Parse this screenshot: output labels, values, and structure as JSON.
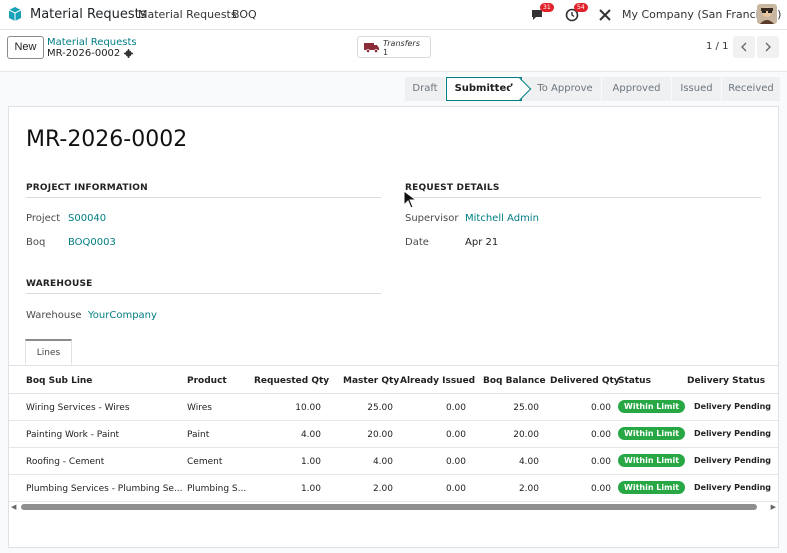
{
  "navbar": {
    "app_title": "Material Requests",
    "menus": [
      "Material Requests",
      "BOQ"
    ],
    "messages_badge": "31",
    "activities_badge": "54",
    "company": "My Company (San Francisco)"
  },
  "control_panel": {
    "new_label": "New",
    "breadcrumb_parent": "Material Requests",
    "record_name": "MR-2026-0002",
    "smart_button": {
      "label": "Transfers",
      "count": "1"
    },
    "pager": "1 / 1"
  },
  "statusbar": {
    "stages": [
      "Draft",
      "Submitted",
      "To Approve",
      "Approved",
      "Issued",
      "Received"
    ],
    "active": "Submitted"
  },
  "form": {
    "title": "MR-2026-0002",
    "project_info": {
      "heading": "PROJECT INFORMATION",
      "project_label": "Project",
      "project_value": "S00040",
      "boq_label": "Boq",
      "boq_value": "BOQ0003"
    },
    "request_details": {
      "heading": "REQUEST DETAILS",
      "supervisor_label": "Supervisor",
      "supervisor_value": "Mitchell Admin",
      "date_label": "Date",
      "date_value": "Apr 21"
    },
    "warehouse": {
      "heading": "WAREHOUSE",
      "warehouse_label": "Warehouse",
      "warehouse_value": "YourCompany"
    },
    "tab_label": "Lines"
  },
  "lines": {
    "headers": [
      "Boq Sub Line",
      "Product",
      "Requested Qty",
      "Master Qty",
      "Already Issued",
      "Boq Balance",
      "Delivered Qty",
      "Status",
      "Delivery Status"
    ],
    "rows": [
      {
        "sub_line": "Wiring Services - Wires",
        "product": "Wires",
        "requested": "10.00",
        "master": "25.00",
        "issued": "0.00",
        "balance": "25.00",
        "delivered": "0.00",
        "status": "Within Limit",
        "delivery": "Delivery Pending"
      },
      {
        "sub_line": "Painting Work - Paint",
        "product": "Paint",
        "requested": "4.00",
        "master": "20.00",
        "issued": "0.00",
        "balance": "20.00",
        "delivered": "0.00",
        "status": "Within Limit",
        "delivery": "Delivery Pending"
      },
      {
        "sub_line": "Roofing - Cement",
        "product": "Cement",
        "requested": "1.00",
        "master": "4.00",
        "issued": "0.00",
        "balance": "4.00",
        "delivered": "0.00",
        "status": "Within Limit",
        "delivery": "Delivery Pending"
      },
      {
        "sub_line": "Plumbing Services - Plumbing Se...",
        "product": "Plumbing S...",
        "requested": "1.00",
        "master": "2.00",
        "issued": "0.00",
        "balance": "2.00",
        "delivered": "0.00",
        "status": "Within Limit",
        "delivery": "Delivery Pending"
      }
    ]
  },
  "colors": {
    "accent": "#017e84",
    "status_green": "#28a745",
    "badge_red": "#e0232b"
  }
}
